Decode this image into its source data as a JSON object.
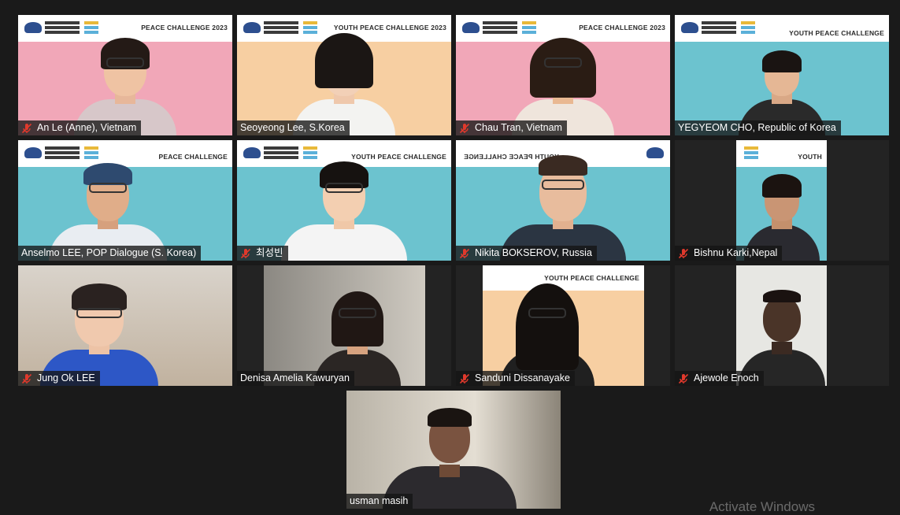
{
  "participants": [
    {
      "name": "An Le (Anne), Vietnam",
      "muted": true,
      "banner": "PEACE CHALLENGE 2023"
    },
    {
      "name": "Seoyeong Lee, S.Korea",
      "muted": false,
      "banner": "YOUTH PEACE CHALLENGE 2023"
    },
    {
      "name": "Chau Tran, Vietnam",
      "muted": true,
      "banner": "PEACE CHALLENGE 2023"
    },
    {
      "name": "YEGYEOM CHO, Republic of Korea",
      "muted": false,
      "banner": "YOUTH PEACE CHALLENGE"
    },
    {
      "name": "Anselmo LEE, POP Dialogue (S. Korea)",
      "muted": false,
      "active_speaker": true,
      "banner": "PEACE CHALLENGE"
    },
    {
      "name": "최성빈",
      "muted": true,
      "banner": "YOUTH PEACE CHALLENGE"
    },
    {
      "name": "Nikita BOKSEROV, Russia",
      "muted": true,
      "banner": "YOUTH PEACE CHALLENGE"
    },
    {
      "name": "Bishnu Karki,Nepal",
      "muted": true,
      "banner": "YOUTH"
    },
    {
      "name": "Jung Ok LEE",
      "muted": true
    },
    {
      "name": "Denisa Amelia Kawuryan",
      "muted": false
    },
    {
      "name": "Sanduni Dissanayake",
      "muted": true,
      "banner": "YOUTH PEACE CHALLENGE"
    },
    {
      "name": "Ajewole Enoch",
      "muted": true
    },
    {
      "name": "usman masih",
      "muted": false
    }
  ],
  "watermark_text": "Activate Windows",
  "colors": {
    "background": "#1a1a1a",
    "active_speaker_border": "#b6d35e",
    "mute_icon": "#e0392c",
    "name_tag_bg": "rgba(20,20,20,0.78)"
  }
}
